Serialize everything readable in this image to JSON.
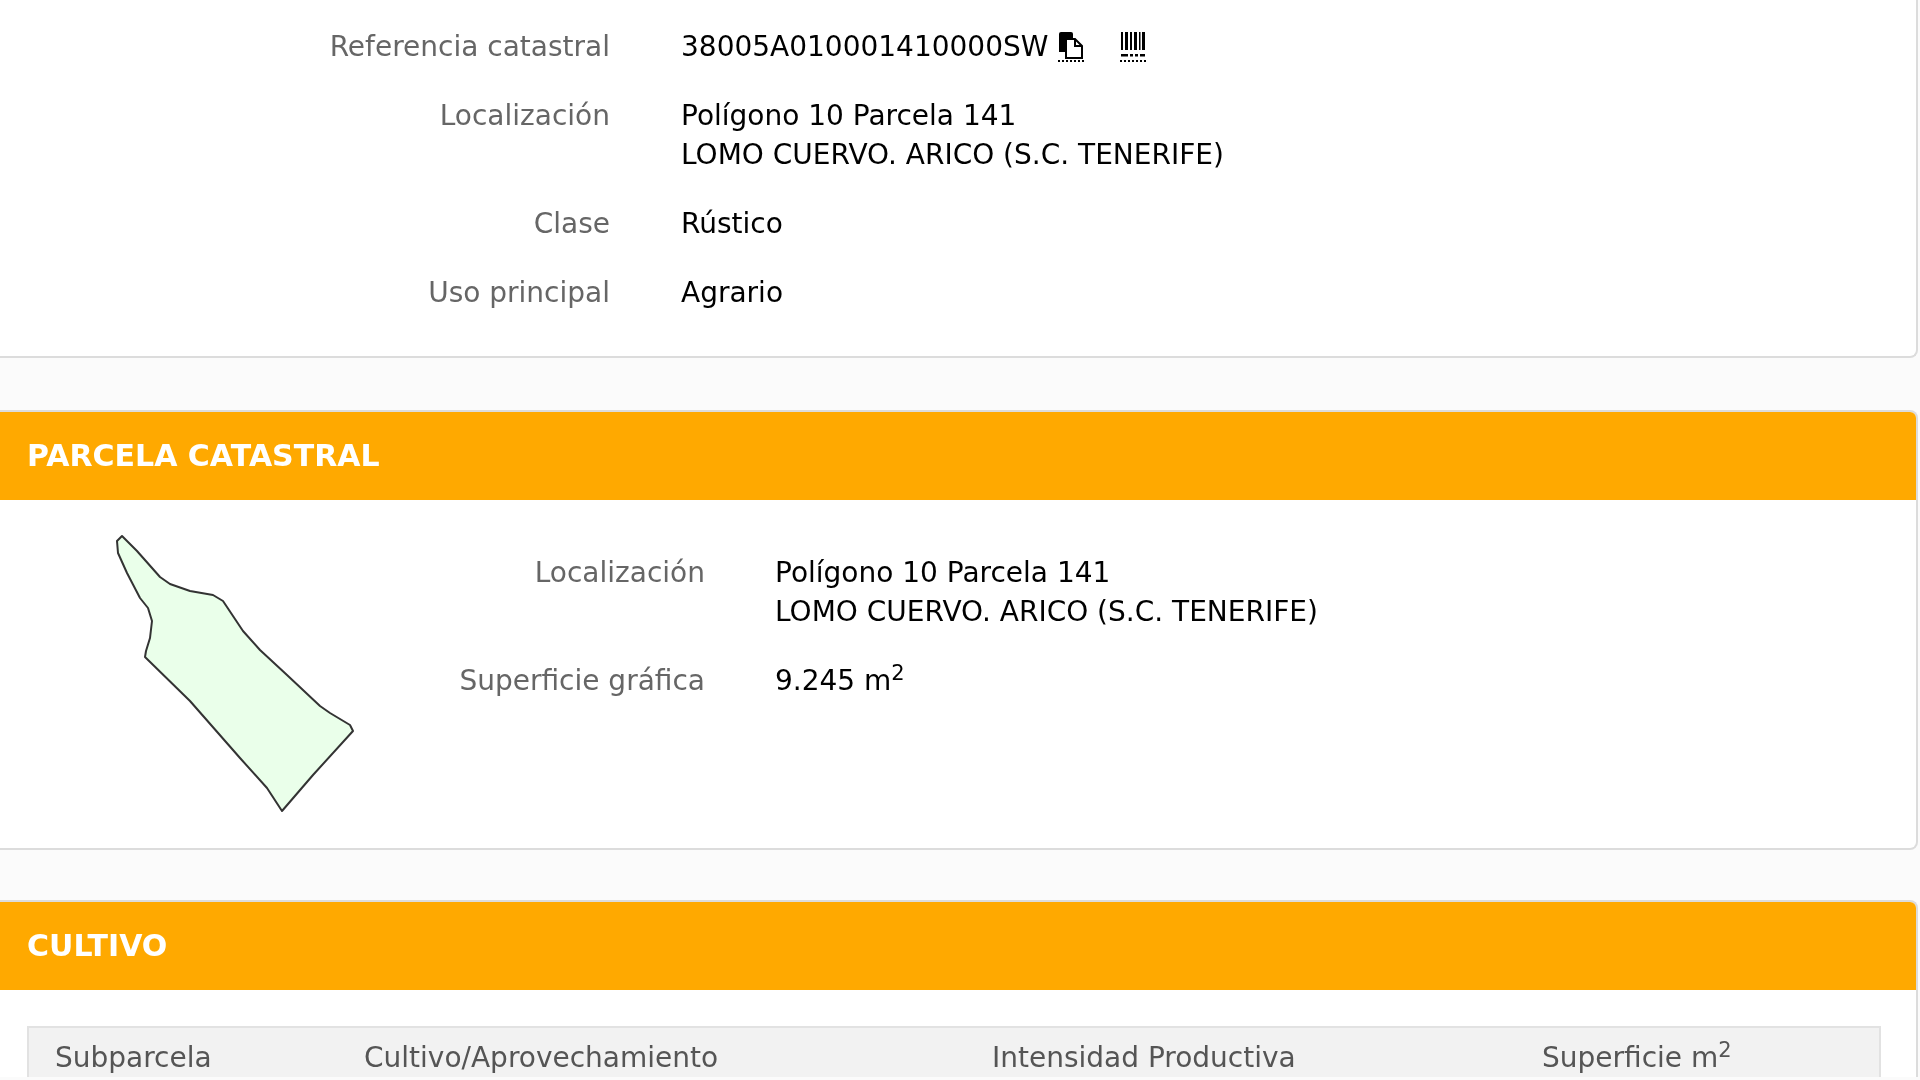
{
  "summary": {
    "rows": [
      {
        "kind": "reference",
        "label": "Referencia catastral",
        "lines": [
          "38005A010001410000SW"
        ]
      },
      {
        "kind": "plain",
        "label": "Localización",
        "lines": [
          "Polígono 10 Parcela 141",
          "LOMO CUERVO. ARICO (S.C. TENERIFE)"
        ]
      },
      {
        "kind": "plain",
        "label": "Clase",
        "lines": [
          "Rústico"
        ]
      },
      {
        "kind": "plain",
        "label": "Uso principal",
        "lines": [
          "Agrario"
        ]
      }
    ]
  },
  "sections": [
    {
      "kind": "parcel",
      "title": "PARCELA CATASTRAL",
      "rows": [
        {
          "label": "Localización",
          "lines": [
            "Polígono 10 Parcela 141",
            "LOMO CUERVO. ARICO (S.C. TENERIFE)"
          ]
        },
        {
          "label": "Superficie gráfica",
          "lines": [
            "9.245 m$^{2}$"
          ]
        }
      ]
    },
    {
      "kind": "table",
      "title": "CULTIVO",
      "columns": [
        "Subparcela",
        "Cultivo/Aprovechamiento",
        "Intensidad Productiva",
        "Superficie m$^{2}$"
      ]
    }
  ]
}
